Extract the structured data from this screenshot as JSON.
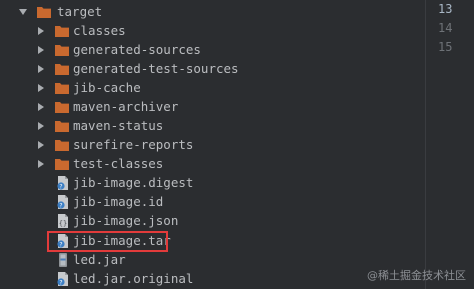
{
  "project_tree": {
    "root": {
      "label": "target",
      "expanded": true
    },
    "folders": [
      {
        "label": "classes"
      },
      {
        "label": "generated-sources"
      },
      {
        "label": "generated-test-sources"
      },
      {
        "label": "jib-cache"
      },
      {
        "label": "maven-archiver"
      },
      {
        "label": "maven-status"
      },
      {
        "label": "surefire-reports"
      },
      {
        "label": "test-classes"
      }
    ],
    "files": [
      {
        "label": "jib-image.digest",
        "icon": "unknown-file-icon"
      },
      {
        "label": "jib-image.id",
        "icon": "unknown-file-icon"
      },
      {
        "label": "jib-image.json",
        "icon": "json-file-icon"
      },
      {
        "label": "jib-image.tar",
        "icon": "unknown-file-icon",
        "highlighted": true
      },
      {
        "label": "led.jar",
        "icon": "jar-file-icon"
      },
      {
        "label": "led.jar.original",
        "icon": "unknown-file-icon"
      }
    ]
  },
  "editor_gutter": {
    "line_numbers": [
      "13",
      "14",
      "15"
    ]
  },
  "watermark": "@稀土掘金技术社区",
  "colors": {
    "background": "#2b2d30",
    "text": "#bbbdc0",
    "folder": "#c9692f",
    "highlight_border": "#e23b3b"
  }
}
